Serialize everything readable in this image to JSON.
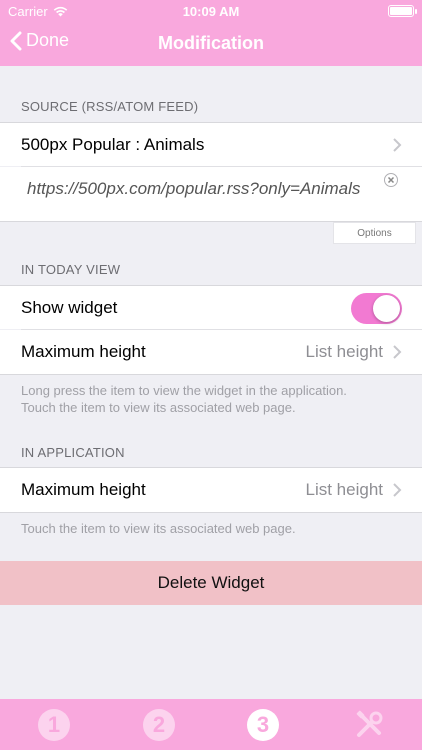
{
  "status": {
    "carrier": "Carrier",
    "time": "10:09 AM"
  },
  "nav": {
    "back_label": "Done",
    "title": "Modification"
  },
  "source": {
    "header": "SOURCE (RSS/ATOM FEED)",
    "feed_name": "500px Popular : Animals",
    "url": "https://500px.com/popular.rss?only=Animals",
    "options_label": "Options"
  },
  "today": {
    "header": "IN TODAY VIEW",
    "show_widget_label": "Show widget",
    "show_widget_on": true,
    "max_height_label": "Maximum height",
    "max_height_value": "List height",
    "footnote_1": "Long press the item to view the widget in the application.",
    "footnote_2": "Touch the item to view its associated web page."
  },
  "application": {
    "header": "IN APPLICATION",
    "max_height_label": "Maximum height",
    "max_height_value": "List height",
    "footnote": "Touch the item to view its associated web page."
  },
  "delete_label": "Delete Widget",
  "tabs": [
    {
      "label": "1",
      "active": false
    },
    {
      "label": "2",
      "active": false
    },
    {
      "label": "3",
      "active": true
    },
    {
      "label": "tools-icon",
      "active": false
    }
  ],
  "colors": {
    "bar": "#f9a8dd",
    "toggle_on": "#f27ad2",
    "delete_bg": "#f1c1c7",
    "background": "#efeff4"
  }
}
